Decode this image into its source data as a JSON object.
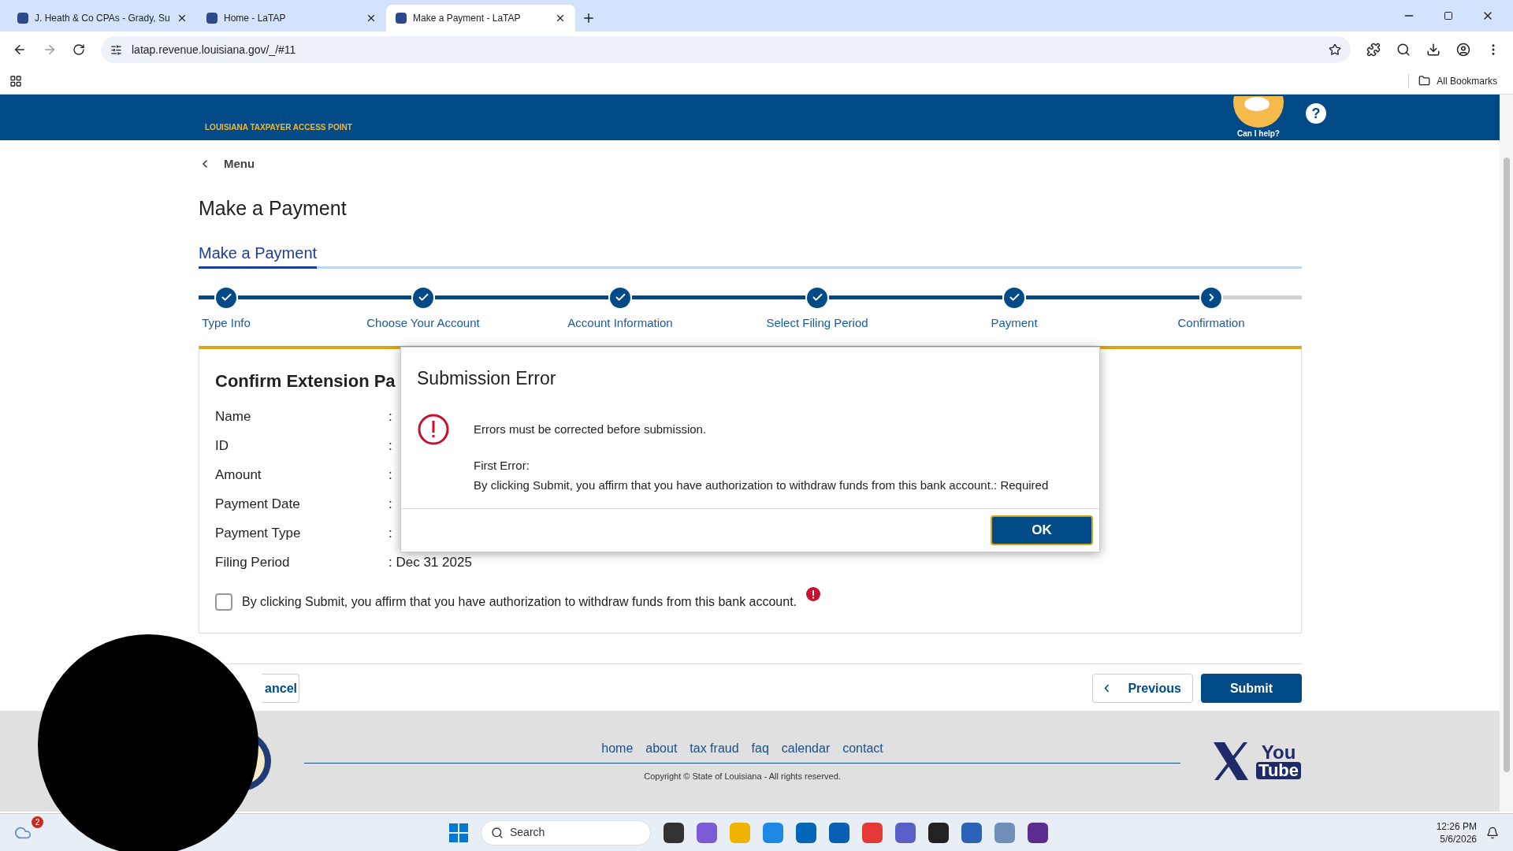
{
  "browser": {
    "tabs": [
      {
        "title": "J. Heath & Co CPAs - Grady, Su",
        "selected": false
      },
      {
        "title": "Home - LaTAP",
        "selected": false
      },
      {
        "title": "Make a Payment - LaTAP",
        "selected": true
      }
    ],
    "url": "latap.revenue.louisiana.gov/_/#11",
    "bookmarks_label": "All Bookmarks"
  },
  "header": {
    "logo_subtitle": "LOUISIANA TAXPAYER ACCESS POINT",
    "help_label": "Can I help?",
    "help_icon": "?"
  },
  "menu_label": "Menu",
  "page_title": "Make a Payment",
  "tabs": [
    {
      "label": "Make a Payment",
      "selected": true
    }
  ],
  "steps": [
    {
      "label": "Type Info",
      "completed": true
    },
    {
      "label": "Choose Your Account",
      "completed": true
    },
    {
      "label": "Account Information",
      "completed": true
    },
    {
      "label": "Select Filing Period",
      "completed": true
    },
    {
      "label": "Payment",
      "completed": true
    },
    {
      "label": "Confirmation",
      "completed": false
    }
  ],
  "card": {
    "title": "Confirm Extension Pa",
    "fields": [
      {
        "label": "Name",
        "value": ":"
      },
      {
        "label": "ID",
        "value": ":"
      },
      {
        "label": "Amount",
        "value": ":"
      },
      {
        "label": "Payment Date",
        "value": ":"
      },
      {
        "label": "Payment Type",
        "value": ":"
      },
      {
        "label": "Filing Period",
        "value": ": Dec 31 2025"
      }
    ],
    "agreement": {
      "label": "By clicking Submit, you affirm that you have authorization to withdraw funds from this bank account.",
      "checked": false,
      "error": true
    }
  },
  "dialog": {
    "title": "Submission Error",
    "message": "Errors must be corrected before submission.",
    "error_heading": "First Error:",
    "error_detail": "By clicking Submit, you affirm that you have authorization to withdraw funds from this bank account.: Required",
    "button": "OK"
  },
  "buttons": {
    "cancel": "ancel",
    "previous": "Previous",
    "submit": "Submit"
  },
  "footer": {
    "links": [
      "home",
      "about",
      "tax fraud",
      "faq",
      "calendar",
      "contact"
    ],
    "copyright": "Copyright © State of Louisiana - All rights reserved.",
    "youtube_top": "You",
    "youtube_bottom": "Tube"
  },
  "taskbar": {
    "weather_badge": "2",
    "search_placeholder": "Search",
    "time": "12:26 PM",
    "date": "5/6/2026"
  }
}
